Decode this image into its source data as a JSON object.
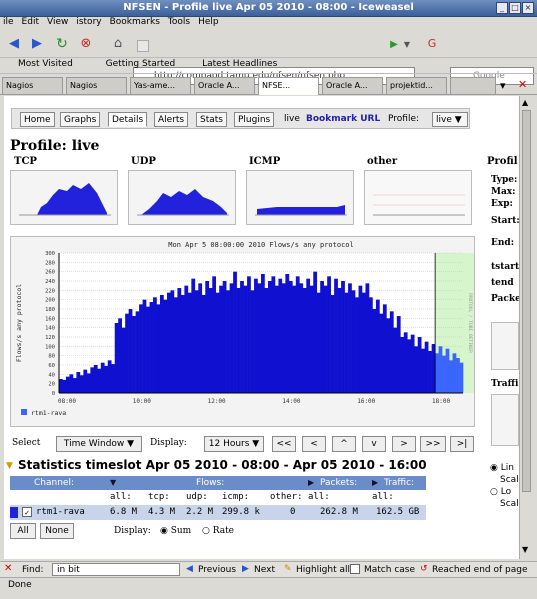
{
  "window": {
    "title": "NFSEN - Profile live Apr 05 2010 - 08:00 - Iceweasel"
  },
  "menu": [
    "ile",
    "Edit",
    "View",
    "istory",
    "Bookmarks",
    "Tools",
    "Help"
  ],
  "nav": {
    "url": "http://compaod.tamu.edu/nfsen/nfsen.php",
    "search_placeholder": "Google"
  },
  "bookmarks": [
    "Most Visited",
    "Getting Started",
    "Latest Headlines"
  ],
  "tabs": [
    "Nagios",
    "Nagios",
    "Yas-ame...",
    "Oracle A...",
    "NFSE...",
    "Oracle A...",
    "projektid...",
    ""
  ],
  "nfsen": {
    "nav": [
      "Home",
      "Graphs",
      "Details",
      "Alerts",
      "Stats",
      "Plugins",
      "live",
      "Bookmark URL",
      "Profile:",
      "live"
    ],
    "title": "Profile: live",
    "thumb_labels": [
      "TCP",
      "UDP",
      "ICMP",
      "other"
    ],
    "side": {
      "title": "Profil",
      "items": [
        "Type:",
        "Max:",
        "Exp:",
        "Start:",
        "End:",
        "tstart",
        "tend",
        "Packe",
        "Traffi"
      ]
    },
    "radios": [
      "Lin",
      "Scale",
      "Lo",
      "Scale"
    ],
    "big_title": "Mon Apr  5 08:00:00 2010  Flows/s any protocol",
    "big_ylabel": "Flows/s any protocol",
    "big_right": "RRDTOOL / TOBI OETIKER",
    "legend": "rtm1-rava",
    "select": {
      "label": "Select",
      "value": "Time Window",
      "display_label": "Display:",
      "display_value": "12 Hours",
      "buttons": [
        "<<",
        "<",
        "^",
        "v",
        ">",
        ">>",
        ">|"
      ]
    },
    "stats_title": "Statistics timeslot Apr 05 2010 - 08:00 - Apr 05 2010 - 16:00",
    "table": {
      "groups": [
        "Channel:",
        "Flows:",
        "Packets:",
        "Traffic:"
      ],
      "cols": [
        "all:",
        "tcp:",
        "udp:",
        "icmp:",
        "other:",
        "all:",
        "all:"
      ],
      "row": {
        "channel": "rtm1-rava",
        "check": "✓",
        "values": [
          "6.8 M",
          "4.3 M",
          "2.2 M",
          "299.8 k",
          "0",
          "262.8 M",
          "162.5 GB"
        ]
      }
    },
    "all_btn": "All",
    "none_btn": "None",
    "display2": {
      "label": "Display:",
      "options": [
        "Sum",
        "Rate"
      ]
    }
  },
  "find": {
    "label": "Find:",
    "value": "in bit",
    "prev": "Previous",
    "next": "Next",
    "highlight": "Highlight all",
    "match": "Match case",
    "status": "Reached end of page"
  },
  "status": "Done",
  "chart_data": {
    "type": "area",
    "title": "Mon Apr  5 08:00:00 2010  Flows/s any protocol",
    "ylabel": "Flows/s any protocol",
    "xlabels": [
      "08:00",
      "10:00",
      "12:00",
      "14:00",
      "16:00",
      "18:00"
    ],
    "ylim": [
      0,
      300
    ],
    "ymajor": [
      0,
      20,
      40,
      60,
      80,
      100,
      120,
      140,
      160,
      180,
      200,
      220,
      240,
      260,
      280,
      300
    ],
    "series": [
      {
        "name": "rtm1-rava",
        "color": "#3a66ff"
      }
    ],
    "values": [
      30,
      28,
      35,
      40,
      32,
      45,
      38,
      50,
      42,
      55,
      60,
      52,
      65,
      58,
      70,
      62,
      150,
      160,
      140,
      170,
      180,
      165,
      175,
      190,
      200,
      185,
      195,
      205,
      190,
      210,
      200,
      215,
      220,
      205,
      225,
      210,
      230,
      215,
      245,
      220,
      235,
      210,
      240,
      225,
      250,
      215,
      230,
      240,
      220,
      235,
      260,
      225,
      240,
      230,
      250,
      220,
      245,
      235,
      255,
      225,
      240,
      250,
      230,
      245,
      235,
      255,
      240,
      230,
      250,
      235,
      225,
      245,
      230,
      260,
      215,
      240,
      230,
      250,
      210,
      245,
      225,
      240,
      215,
      235,
      220,
      205,
      230,
      215,
      235,
      205,
      180,
      200,
      170,
      190,
      160,
      175,
      140,
      165,
      120,
      130,
      115,
      125,
      100,
      120,
      95,
      110,
      90,
      105,
      85,
      100,
      80,
      95,
      70,
      85,
      75,
      65
    ],
    "band_left": [
      108,
      270
    ],
    "highlight_window": [
      108,
      270
    ]
  }
}
